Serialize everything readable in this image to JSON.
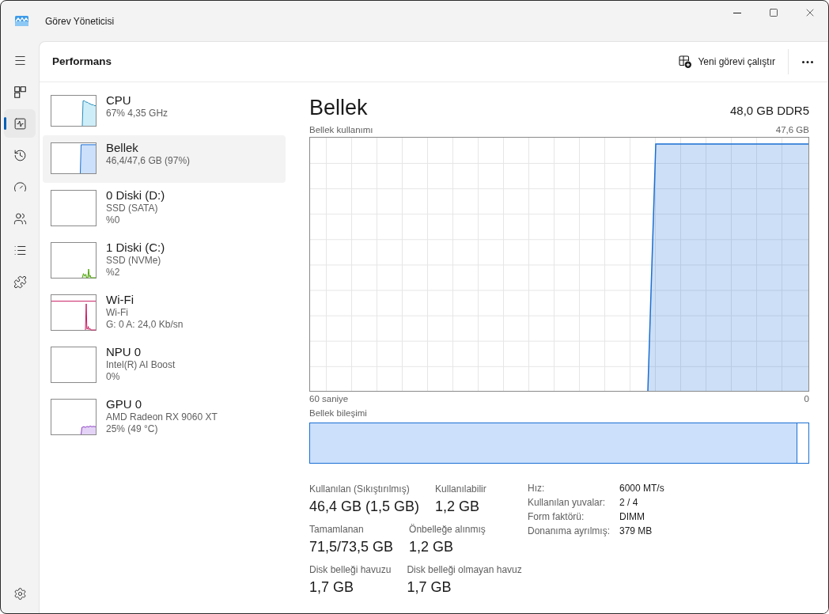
{
  "window": {
    "title": "Görev Yöneticisi"
  },
  "nav": {
    "items": [
      {
        "kind": "processes",
        "selected": false
      },
      {
        "kind": "performance",
        "selected": true
      },
      {
        "kind": "history",
        "selected": false
      },
      {
        "kind": "startup",
        "selected": false
      },
      {
        "kind": "users",
        "selected": false
      },
      {
        "kind": "details",
        "selected": false
      },
      {
        "kind": "services",
        "selected": false
      }
    ]
  },
  "header": {
    "title": "Performans",
    "action": "Yeni görevi çalıştır"
  },
  "sidebar": {
    "items": [
      {
        "kind": "cpu",
        "title": "CPU",
        "lines": [
          "67% 4,35 GHz"
        ],
        "selected": false
      },
      {
        "kind": "memory",
        "title": "Bellek",
        "lines": [
          "46,4/47,6 GB (97%)"
        ],
        "selected": true
      },
      {
        "kind": "idle",
        "title": "0 Diski (D:)",
        "lines": [
          "SSD (SATA)",
          "%0"
        ],
        "selected": false
      },
      {
        "kind": "disk",
        "title": "1 Diski (C:)",
        "lines": [
          "SSD (NVMe)",
          "%2"
        ],
        "selected": false
      },
      {
        "kind": "network",
        "title": "Wi-Fi",
        "lines": [
          "Wi-Fi",
          "G: 0 A: 24,0 Kb/sn"
        ],
        "selected": false
      },
      {
        "kind": "idle",
        "title": "NPU 0",
        "lines": [
          "Intel(R) AI Boost",
          "0%"
        ],
        "selected": false
      },
      {
        "kind": "gpu",
        "title": "GPU 0",
        "lines": [
          "AMD Radeon RX 9060 XT",
          "25% (49 °C)"
        ],
        "selected": false
      }
    ]
  },
  "detail": {
    "title": "Bellek",
    "capacity": "48,0 GB DDR5",
    "graph": {
      "label": "Bellek kullanımı",
      "max": "47,6 GB",
      "x_start": "60 saniye",
      "x_end": "0"
    },
    "composition": {
      "label": "Bellek bileşimi",
      "level": 0.978
    },
    "stats": [
      {
        "cells": [
          {
            "label": "Kullanılan (Sıkıştırılmış)",
            "value": "46,4 GB (1,5 GB)"
          },
          {
            "label": "Kullanılabilir",
            "value": "1,2 GB"
          }
        ]
      },
      {
        "cells": [
          {
            "label": "Tamamlanan",
            "value": "71,5/73,5 GB"
          },
          {
            "label": "Önbelleğe alınmış",
            "value": "1,2 GB"
          }
        ]
      },
      {
        "cells": [
          {
            "label": "Disk belleği havuzu",
            "value": "1,7 GB"
          },
          {
            "label": "Disk belleği olmayan havuz",
            "value": "1,7 GB"
          }
        ]
      }
    ],
    "properties": [
      {
        "label": "Hız:",
        "value": "6000 MT/s"
      },
      {
        "label": "Kullanılan yuvalar:",
        "value": "2 / 4"
      },
      {
        "label": "Form faktörü:",
        "value": "DIMM"
      },
      {
        "label": "Donanıma ayrılmış:",
        "value": "379 MB"
      }
    ]
  }
}
